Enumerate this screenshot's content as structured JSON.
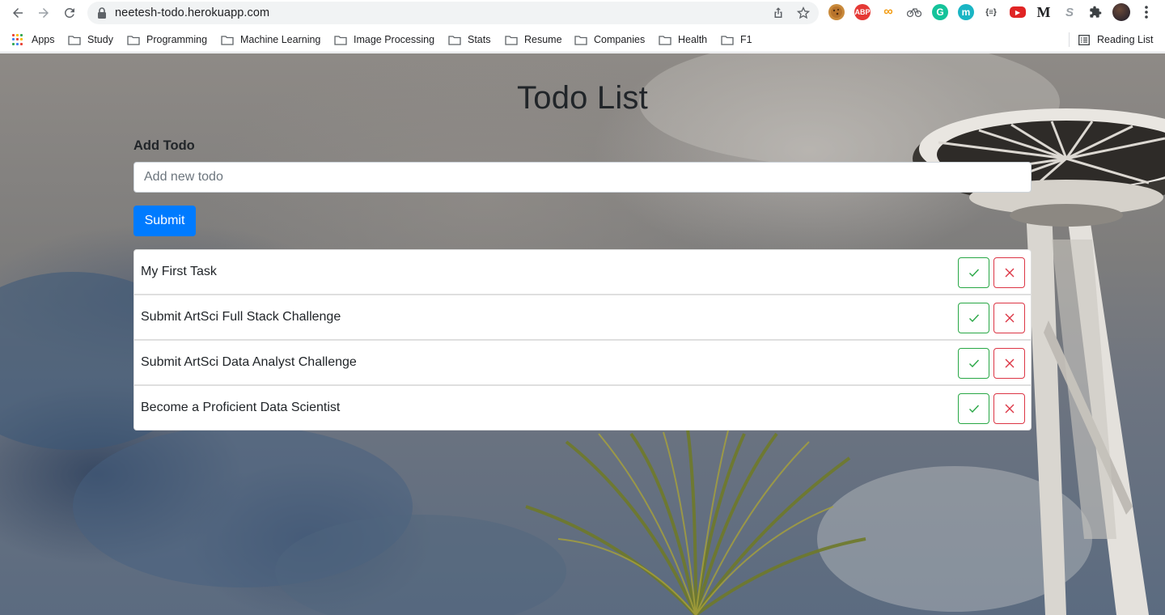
{
  "browser": {
    "url": "neetesh-todo.herokuapp.com",
    "bookmarks": [
      {
        "label": "Apps",
        "icon": "apps-grid-icon"
      },
      {
        "label": "Study",
        "icon": "folder-icon"
      },
      {
        "label": "Programming",
        "icon": "folder-icon"
      },
      {
        "label": "Machine Learning",
        "icon": "folder-icon"
      },
      {
        "label": "Image Processing",
        "icon": "folder-icon"
      },
      {
        "label": "Stats",
        "icon": "folder-icon"
      },
      {
        "label": "Resume",
        "icon": "folder-icon"
      },
      {
        "label": "Companies",
        "icon": "folder-icon"
      },
      {
        "label": "Health",
        "icon": "folder-icon"
      },
      {
        "label": "F1",
        "icon": "folder-icon"
      }
    ],
    "reading_list": "Reading List",
    "extensions": [
      {
        "name": "cookie-extension-icon",
        "text": ""
      },
      {
        "name": "adblock-plus-icon",
        "text": "ABP"
      },
      {
        "name": "infinity-extension-icon",
        "text": "∞"
      },
      {
        "name": "bike-extension-icon",
        "text": ""
      },
      {
        "name": "grammarly-icon",
        "text": "G"
      },
      {
        "name": "m-extension-icon",
        "text": "m"
      },
      {
        "name": "json-formatter-icon",
        "text": "{≡}"
      },
      {
        "name": "youtube-extension-icon",
        "text": "▶"
      },
      {
        "name": "medium-extension-icon",
        "text": "M"
      },
      {
        "name": "s-extension-icon",
        "text": "S"
      }
    ]
  },
  "page": {
    "title": "Todo List",
    "add_label": "Add Todo",
    "input_placeholder": "Add new todo",
    "input_value": "",
    "submit_label": "Submit",
    "todos": [
      {
        "text": "My First Task"
      },
      {
        "text": "Submit ArtSci Full Stack Challenge"
      },
      {
        "text": "Submit ArtSci Data Analyst Challenge"
      },
      {
        "text": "Become a Proficient Data Scientist"
      }
    ]
  },
  "colors": {
    "primary": "#007bff",
    "success": "#28a745",
    "danger": "#dc3545"
  }
}
